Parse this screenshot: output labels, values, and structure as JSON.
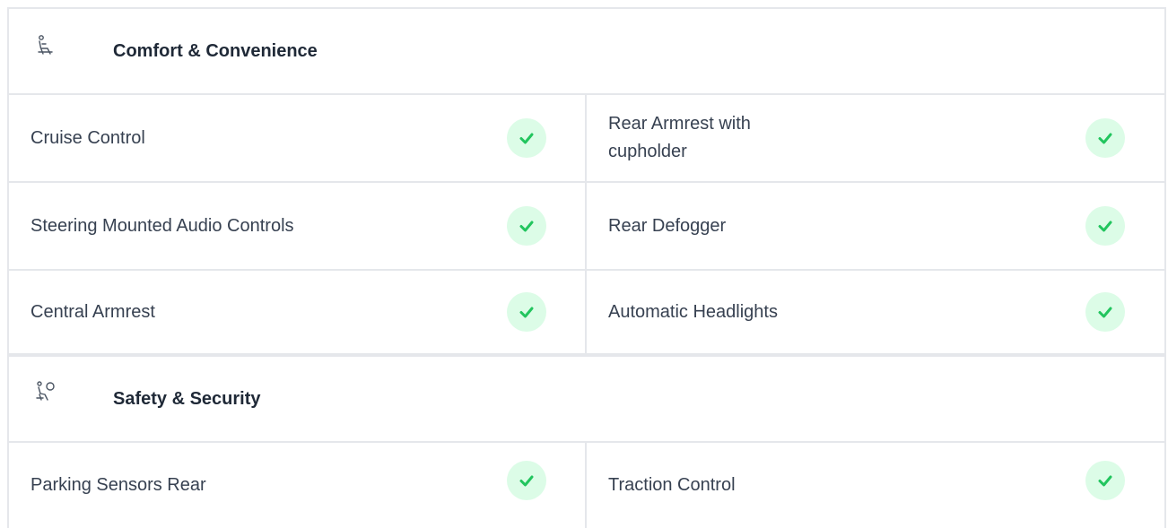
{
  "sections": [
    {
      "title": "Comfort & Convenience",
      "icon": "seat-icon",
      "rows": [
        [
          "Cruise Control",
          "Rear Armrest with cupholder"
        ],
        [
          "Steering Mounted Audio Controls",
          "Rear Defogger"
        ],
        [
          "Central Armrest",
          "Automatic Headlights"
        ]
      ]
    },
    {
      "title": "Safety & Security",
      "icon": "airbag-icon",
      "rows": [
        [
          "Parking Sensors Rear",
          "Traction Control"
        ]
      ]
    }
  ],
  "colors": {
    "check": "#22c55e",
    "check_bg": "#dcfce7",
    "border": "#e5e7eb"
  }
}
